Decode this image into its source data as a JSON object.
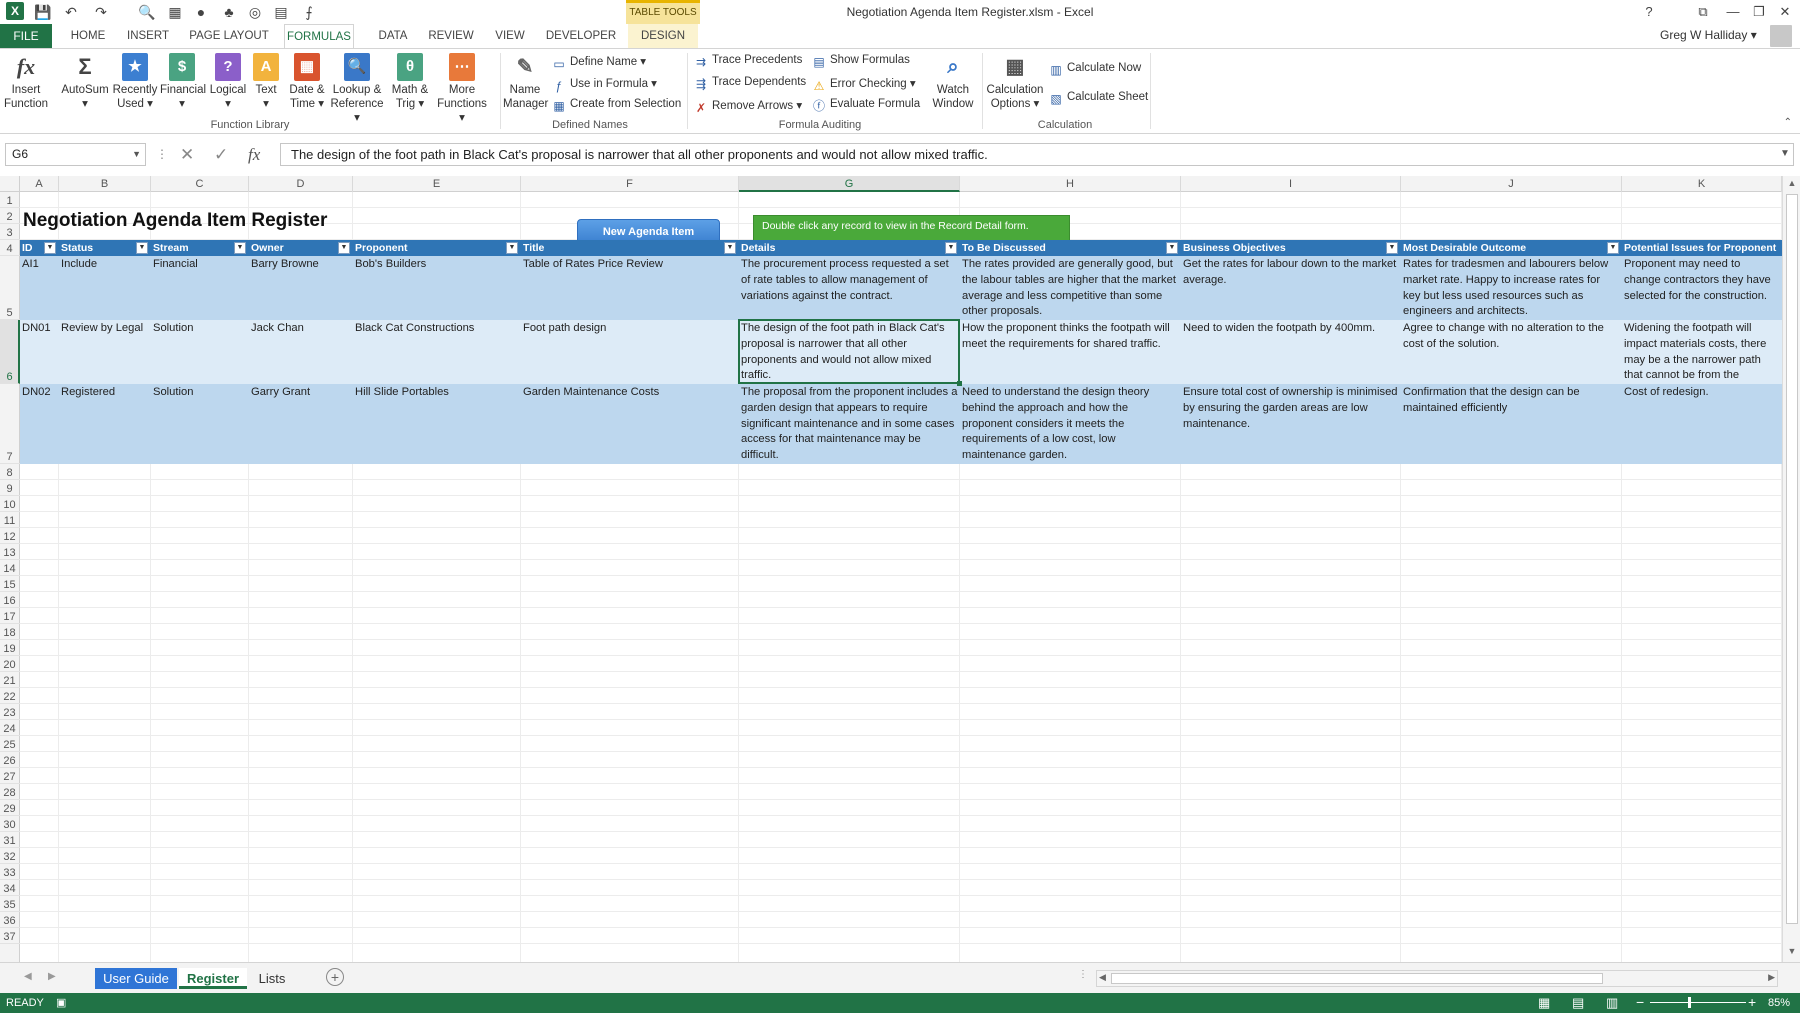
{
  "window": {
    "title": "Negotiation Agenda Item Register.xlsm - Excel",
    "table_tools": "TABLE TOOLS",
    "user": "Greg W Halliday",
    "controls": [
      "?",
      "⧉",
      "—",
      "❐",
      "✕"
    ]
  },
  "qat": [
    "💾",
    "↶",
    "↷",
    "🔍",
    "▦",
    "●",
    "♣",
    "◎",
    "▤",
    "⨍"
  ],
  "tabs": {
    "file": "FILE",
    "items": [
      "HOME",
      "INSERT",
      "PAGE LAYOUT",
      "FORMULAS",
      "DATA",
      "REVIEW",
      "VIEW",
      "DEVELOPER",
      "DESIGN"
    ],
    "active": "FORMULAS"
  },
  "ribbon": {
    "function_library": {
      "label": "Function Library",
      "buttons": [
        {
          "l1": "Insert",
          "l2": "Function",
          "icon": "fx",
          "color": "#ffffff"
        },
        {
          "l1": "AutoSum",
          "l2": "▾",
          "icon": "Σ",
          "color": "#ffffff"
        },
        {
          "l1": "Recently",
          "l2": "Used ▾",
          "icon": "★",
          "color": "#3c7fd1"
        },
        {
          "l1": "Financial",
          "l2": "▾",
          "icon": "$",
          "color": "#4aa382"
        },
        {
          "l1": "Logical",
          "l2": "▾",
          "icon": "?",
          "color": "#8b5fc9"
        },
        {
          "l1": "Text",
          "l2": "▾",
          "icon": "A",
          "color": "#f2b33d"
        },
        {
          "l1": "Date &",
          "l2": "Time ▾",
          "icon": "▦",
          "color": "#d9542e"
        },
        {
          "l1": "Lookup &",
          "l2": "Reference ▾",
          "icon": "🔍",
          "color": "#3a78c8"
        },
        {
          "l1": "Math &",
          "l2": "Trig ▾",
          "icon": "θ",
          "color": "#4aa382"
        },
        {
          "l1": "More",
          "l2": "Functions ▾",
          "icon": "⋯",
          "color": "#e8793a"
        }
      ]
    },
    "defined_names": {
      "label": "Defined Names",
      "name_manager": {
        "l1": "Name",
        "l2": "Manager"
      },
      "define_name": "Define Name ▾",
      "use_in_formula": "Use in Formula ▾",
      "create_from_selection": "Create from Selection"
    },
    "formula_auditing": {
      "label": "Formula Auditing",
      "trace_precedents": "Trace Precedents",
      "trace_dependents": "Trace Dependents",
      "remove_arrows": "Remove Arrows ▾",
      "show_formulas": "Show Formulas",
      "error_checking": "Error Checking ▾",
      "evaluate_formula": "Evaluate Formula",
      "watch_window": {
        "l1": "Watch",
        "l2": "Window"
      }
    },
    "calculation": {
      "label": "Calculation",
      "options": {
        "l1": "Calculation",
        "l2": "Options ▾"
      },
      "calculate_now": "Calculate Now",
      "calculate_sheet": "Calculate Sheet"
    }
  },
  "formula_bar": {
    "name_box": "G6",
    "formula": "The design of the foot path in Black Cat's proposal is narrower that all other proponents and would not allow mixed traffic."
  },
  "columns": [
    "A",
    "B",
    "C",
    "D",
    "E",
    "F",
    "G",
    "H",
    "I",
    "J",
    "K"
  ],
  "selected_column": "G",
  "selected_row": "6",
  "rows": [
    "1",
    "2",
    "3",
    "4",
    "5",
    "6",
    "7",
    "8",
    "9",
    "10",
    "11",
    "12",
    "13",
    "14",
    "15",
    "16",
    "17",
    "18",
    "19",
    "20",
    "21",
    "22",
    "23",
    "24",
    "25",
    "26",
    "27",
    "28",
    "29",
    "30",
    "31",
    "32",
    "33",
    "34",
    "35",
    "36",
    "37"
  ],
  "sheet": {
    "title": "Negotiation Agenda Item Register",
    "new_item_button": "New Agenda Item",
    "hint": "Double click any record to view in the Record Detail form.",
    "table_headers": [
      "ID",
      "Status",
      "Stream",
      "Owner",
      "Proponent",
      "Title",
      "Details",
      "To Be Discussed",
      "Business Objectives",
      "Most Desirable Outcome",
      "Potential Issues for Proponent"
    ],
    "records": [
      [
        "AI1",
        "Include",
        "Financial",
        "Barry Browne",
        "Bob's Builders",
        "Table of Rates Price Review",
        "The procurement process requested a set of rate tables to allow management of variations against the contract.",
        "The rates provided are generally good, but the labour tables are higher that the market average and less competitive than some other proposals.",
        "Get the rates for labour down to the market average.",
        "Rates for tradesmen and labourers below market rate. Happy to increase rates for key but less used resources such as engineers and architects.",
        "Proponent may need to change contractors they have selected for the construction."
      ],
      [
        "DN01",
        "Review by Legal",
        "Solution",
        "Jack Chan",
        "Black Cat Constructions",
        "Foot path design",
        "The design of the foot path in Black Cat's proposal is narrower that all other proponents and would not allow mixed traffic.",
        "How the proponent thinks the footpath will meet the requirements for shared traffic.",
        "Need to widen the footpath by 400mm.",
        "Agree to change with no alteration to the cost of the solution.",
        "Widening the footpath will impact materials costs, there may be a the narrower path that cannot be from the response."
      ],
      [
        "DN02",
        "Registered",
        "Solution",
        "Garry Grant",
        "Hill Slide Portables",
        "Garden Maintenance Costs",
        "The proposal from the proponent includes a garden design that appears to require significant maintenance and in some cases access for that maintenance may be difficult.",
        "Need to understand the design theory behind the approach and how the proponent considers it meets the requirements of a low cost, low maintenance garden.",
        "Ensure total cost of ownership is minimised by ensuring the garden areas are low maintenance.",
        "Confirmation that the design can be maintained efficiently",
        "Cost of redesign."
      ]
    ]
  },
  "sheet_tabs": [
    "User Guide",
    "Register",
    "Lists"
  ],
  "active_sheet": "Register",
  "status": {
    "text": "READY",
    "zoom": "85%"
  }
}
